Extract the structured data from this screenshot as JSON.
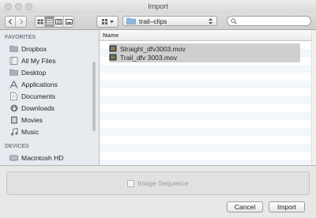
{
  "window": {
    "title": "Import"
  },
  "toolbar": {
    "path_folder": "trail–clips",
    "search_placeholder": ""
  },
  "sidebar": {
    "favorites_header": "FAVORITES",
    "favorites": [
      {
        "label": "Dropbox",
        "icon": "dropbox-icon"
      },
      {
        "label": "All My Files",
        "icon": "all-files-icon"
      },
      {
        "label": "Desktop",
        "icon": "desktop-icon"
      },
      {
        "label": "Applications",
        "icon": "applications-icon"
      },
      {
        "label": "Documents",
        "icon": "documents-icon"
      },
      {
        "label": "Downloads",
        "icon": "downloads-icon"
      },
      {
        "label": "Movies",
        "icon": "movies-icon"
      },
      {
        "label": "Music",
        "icon": "music-icon"
      }
    ],
    "devices_header": "DEVICES",
    "devices": [
      {
        "label": "Macintosh HD",
        "icon": "hard-drive-icon"
      }
    ]
  },
  "file_list": {
    "column_name": "Name",
    "files": [
      {
        "name": "Straight_dfv3003.mov",
        "selected": true
      },
      {
        "name": "Trail_dfv 3003.mov",
        "selected": true
      }
    ]
  },
  "options": {
    "image_sequence_label": "Image Sequence",
    "image_sequence_checked": false
  },
  "buttons": {
    "cancel": "Cancel",
    "import": "Import"
  }
}
